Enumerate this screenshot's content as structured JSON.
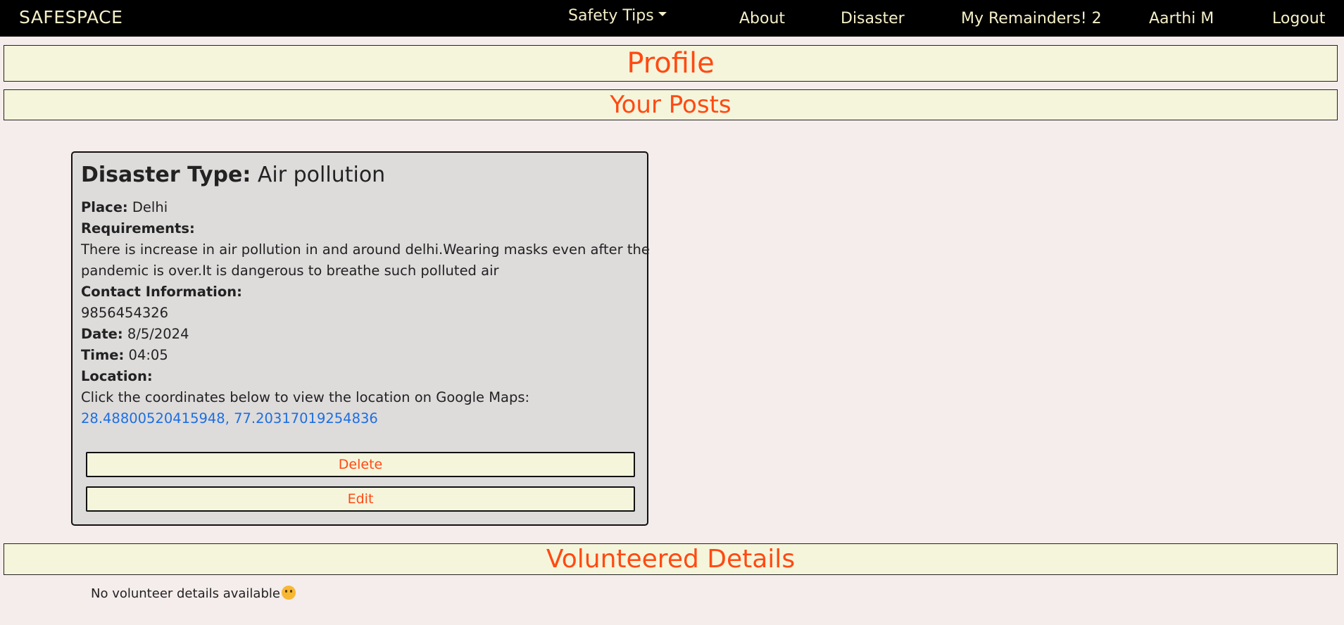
{
  "nav": {
    "brand": "SAFESPACE",
    "safety_tips": "Safety Tips",
    "about": "About",
    "disaster": "Disaster",
    "reminders": "My Remainders! 2",
    "user": "Aarthi M",
    "logout": "Logout"
  },
  "sections": {
    "profile": "Profile",
    "your_posts": "Your Posts",
    "volunteered": "Volunteered Details"
  },
  "post": {
    "type_label": "Disaster Type:",
    "type_value": "Air pollution",
    "place_label": "Place:",
    "place_value": "Delhi",
    "requirements_label": "Requirements:",
    "requirements_line1": "There is increase in air pollution in and around delhi.Wearing masks even after the",
    "requirements_line2": "pandemic is over.It is dangerous to breathe such polluted air",
    "contact_label": "Contact Information:",
    "contact_value": "9856454326",
    "date_label": "Date:",
    "date_value": "8/5/2024",
    "time_label": "Time:",
    "time_value": "04:05",
    "location_label": "Location:",
    "location_hint": "Click the coordinates below to view the location on Google Maps:",
    "coordinates": "28.48800520415948, 77.20317019254836",
    "delete_label": "Delete",
    "edit_label": "Edit"
  },
  "volunteer": {
    "empty_text": "No volunteer details available",
    "emoji_icon": "pleading-face-icon"
  },
  "colors": {
    "accent": "#ff4a12",
    "banner_bg": "#f5f5dc",
    "navbar_bg": "#000000",
    "nav_text": "#f5efc8",
    "link": "#1c6fe0"
  }
}
